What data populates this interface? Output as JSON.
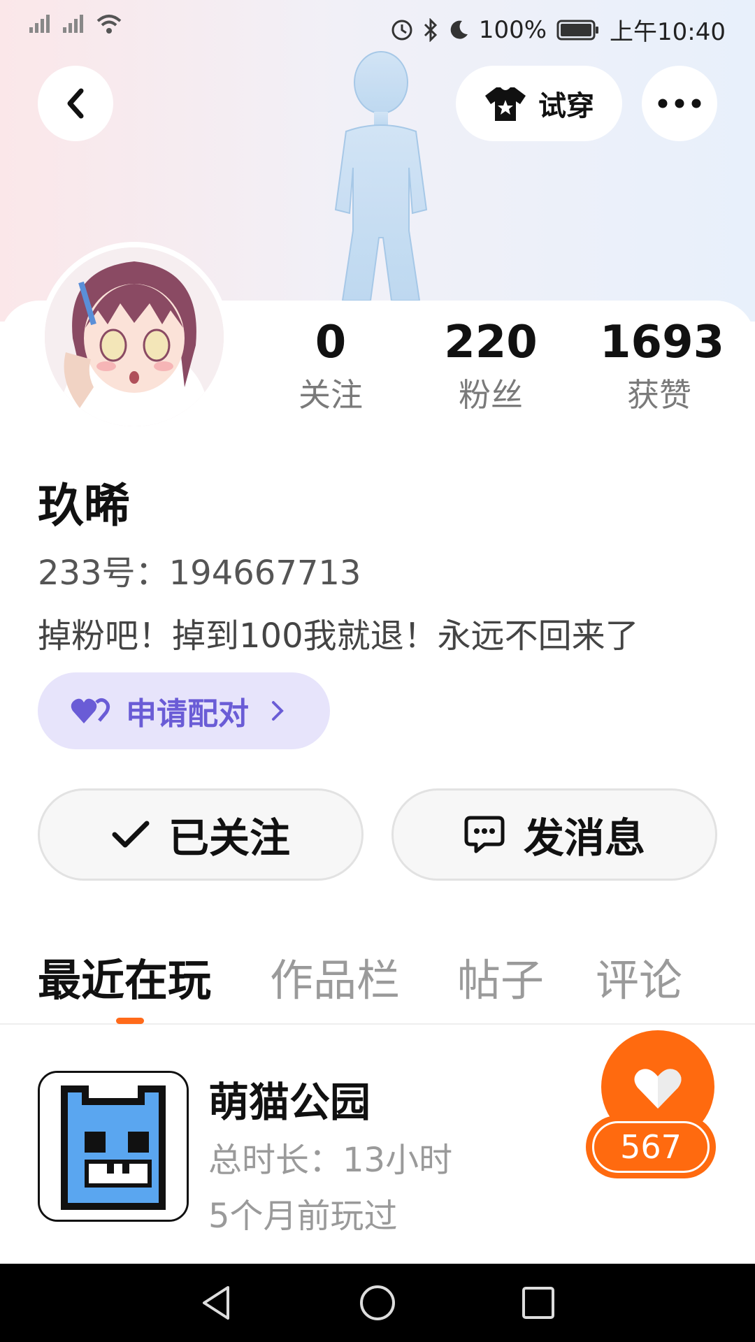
{
  "status_bar": {
    "battery": "100%",
    "time": "上午10:40"
  },
  "header": {
    "tryon_label": "试穿"
  },
  "profile": {
    "stats": [
      {
        "value": "0",
        "label": "关注"
      },
      {
        "value": "220",
        "label": "粉丝"
      },
      {
        "value": "1693",
        "label": "获赞"
      }
    ],
    "name": "玖晞",
    "id_line": "233号：194667713",
    "bio": "掉粉吧！掉到100我就退！永远不回来了",
    "pair_label": "申请配对"
  },
  "actions": {
    "follow_label": "已关注",
    "message_label": "发消息"
  },
  "tabs": [
    {
      "label": "最近在玩",
      "active": true
    },
    {
      "label": "作品栏",
      "active": false
    },
    {
      "label": "帖子",
      "active": false
    },
    {
      "label": "评论",
      "active": false
    }
  ],
  "recent_game": {
    "title": "萌猫公园",
    "duration": "总时长：13小时",
    "last_played": "5个月前玩过",
    "likes": "567"
  },
  "colors": {
    "accent_orange": "#ff6a0f",
    "pair_purple": "#6a5cd6",
    "pair_bg": "#e7e4fb"
  }
}
